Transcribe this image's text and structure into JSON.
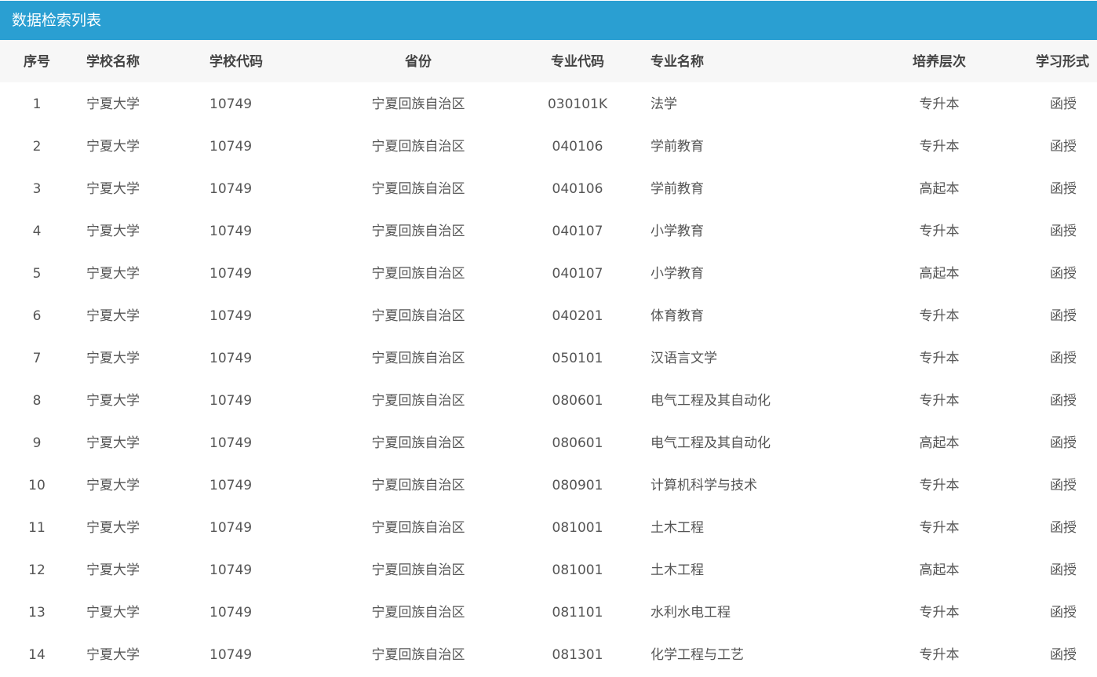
{
  "panel": {
    "title": "数据检索列表"
  },
  "table": {
    "headers": {
      "seq": "序号",
      "school_name": "学校名称",
      "school_code": "学校代码",
      "province": "省份",
      "major_code": "专业代码",
      "major_name": "专业名称",
      "level": "培养层次",
      "mode": "学习形式"
    },
    "rows": [
      {
        "seq": "1",
        "school_name": "宁夏大学",
        "school_code": "10749",
        "province": "宁夏回族自治区",
        "major_code": "030101K",
        "major_name": "法学",
        "level": "专升本",
        "mode": "函授"
      },
      {
        "seq": "2",
        "school_name": "宁夏大学",
        "school_code": "10749",
        "province": "宁夏回族自治区",
        "major_code": "040106",
        "major_name": "学前教育",
        "level": "专升本",
        "mode": "函授"
      },
      {
        "seq": "3",
        "school_name": "宁夏大学",
        "school_code": "10749",
        "province": "宁夏回族自治区",
        "major_code": "040106",
        "major_name": "学前教育",
        "level": "高起本",
        "mode": "函授"
      },
      {
        "seq": "4",
        "school_name": "宁夏大学",
        "school_code": "10749",
        "province": "宁夏回族自治区",
        "major_code": "040107",
        "major_name": "小学教育",
        "level": "专升本",
        "mode": "函授"
      },
      {
        "seq": "5",
        "school_name": "宁夏大学",
        "school_code": "10749",
        "province": "宁夏回族自治区",
        "major_code": "040107",
        "major_name": "小学教育",
        "level": "高起本",
        "mode": "函授"
      },
      {
        "seq": "6",
        "school_name": "宁夏大学",
        "school_code": "10749",
        "province": "宁夏回族自治区",
        "major_code": "040201",
        "major_name": "体育教育",
        "level": "专升本",
        "mode": "函授"
      },
      {
        "seq": "7",
        "school_name": "宁夏大学",
        "school_code": "10749",
        "province": "宁夏回族自治区",
        "major_code": "050101",
        "major_name": "汉语言文学",
        "level": "专升本",
        "mode": "函授"
      },
      {
        "seq": "8",
        "school_name": "宁夏大学",
        "school_code": "10749",
        "province": "宁夏回族自治区",
        "major_code": "080601",
        "major_name": "电气工程及其自动化",
        "level": "专升本",
        "mode": "函授"
      },
      {
        "seq": "9",
        "school_name": "宁夏大学",
        "school_code": "10749",
        "province": "宁夏回族自治区",
        "major_code": "080601",
        "major_name": "电气工程及其自动化",
        "level": "高起本",
        "mode": "函授"
      },
      {
        "seq": "10",
        "school_name": "宁夏大学",
        "school_code": "10749",
        "province": "宁夏回族自治区",
        "major_code": "080901",
        "major_name": "计算机科学与技术",
        "level": "专升本",
        "mode": "函授"
      },
      {
        "seq": "11",
        "school_name": "宁夏大学",
        "school_code": "10749",
        "province": "宁夏回族自治区",
        "major_code": "081001",
        "major_name": "土木工程",
        "level": "专升本",
        "mode": "函授"
      },
      {
        "seq": "12",
        "school_name": "宁夏大学",
        "school_code": "10749",
        "province": "宁夏回族自治区",
        "major_code": "081001",
        "major_name": "土木工程",
        "level": "高起本",
        "mode": "函授"
      },
      {
        "seq": "13",
        "school_name": "宁夏大学",
        "school_code": "10749",
        "province": "宁夏回族自治区",
        "major_code": "081101",
        "major_name": "水利水电工程",
        "level": "专升本",
        "mode": "函授"
      },
      {
        "seq": "14",
        "school_name": "宁夏大学",
        "school_code": "10749",
        "province": "宁夏回族自治区",
        "major_code": "081301",
        "major_name": "化学工程与工艺",
        "level": "专升本",
        "mode": "函授"
      }
    ]
  }
}
